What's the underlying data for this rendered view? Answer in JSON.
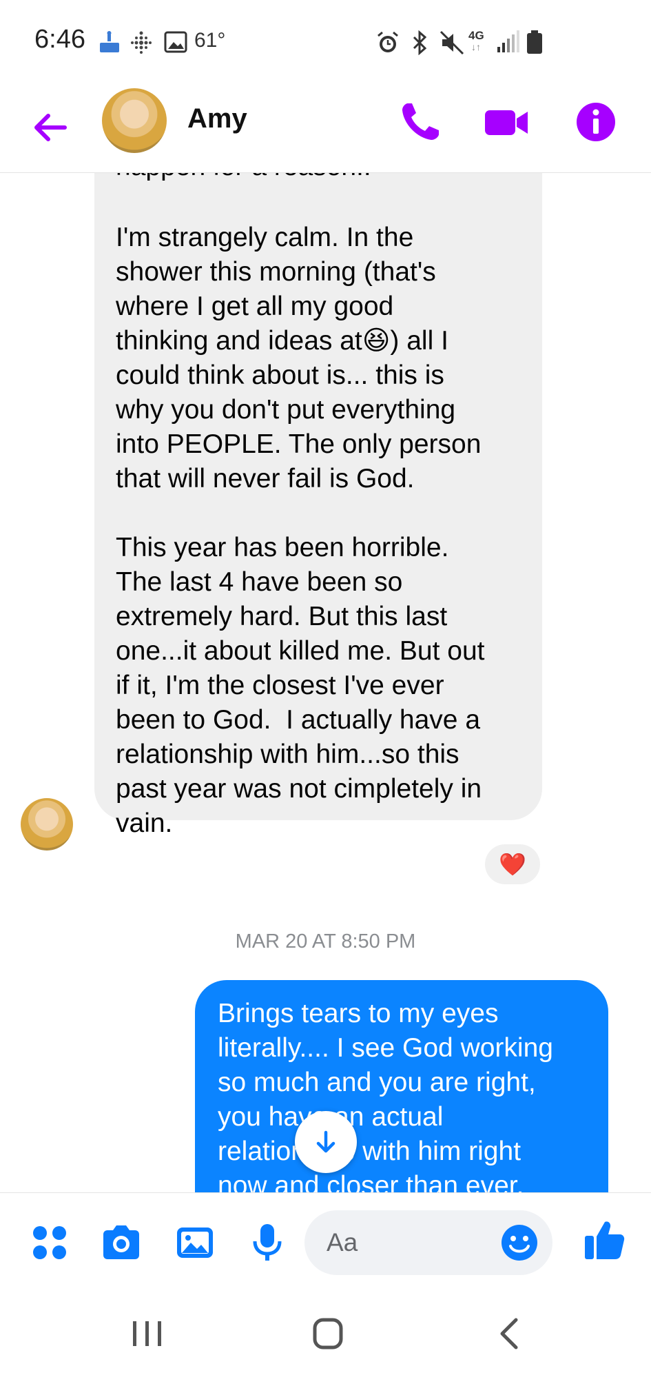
{
  "status_bar": {
    "time": "6:46",
    "temperature": "61°",
    "network": "4G",
    "icons": [
      "birthday-cake-icon",
      "fitbit-icon",
      "gallery-icon",
      "alarm-icon",
      "bluetooth-icon",
      "mute-icon",
      "network-icon",
      "signal-icon",
      "battery-icon"
    ]
  },
  "header": {
    "contact_name": "Amy",
    "accent_color": "#a600ff"
  },
  "messages": {
    "incoming_cut_line": "happen for a reason!.",
    "incoming_text": "I'm strangely calm. In the\nshower this morning (that's\nwhere I get all my good\nthinking and ideas at😆) all I\ncould think about is... this is\nwhy you don't put everything\ninto PEOPLE. The only person\nthat will never fail is God.\n\nThis year has been horrible.\nThe last 4 have been so\nextremely hard. But this last\none...it about killed me. But out\nif it, I'm the closest I've ever\nbeen to God.  I actually have a\nrelationship with him...so this\npast year was not cimpletely in\nvain.",
    "reaction": "❤️",
    "timestamp": "MAR 20 AT 8:50 PM",
    "outgoing_text": "Brings tears to my eyes\nliterally.... I see God working\nso much and you are right,\nyou have an actual\nrelationship with him right\nnow and closer than ever.",
    "outgoing_color": "#0b84ff"
  },
  "composer": {
    "placeholder": "Aa",
    "accent_color": "#0a7cff"
  }
}
